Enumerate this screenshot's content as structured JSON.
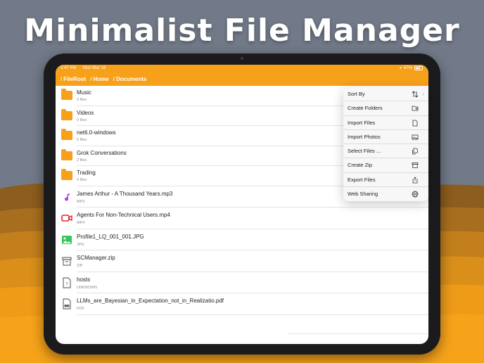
{
  "headline": "Minimalist File Manager",
  "status": {
    "time": "3:47 PM",
    "date": "Mon Mar 16",
    "battery": "67%"
  },
  "breadcrumb": [
    "FileRoot",
    "Home",
    "Documents"
  ],
  "items": [
    {
      "name": "Music",
      "meta": "0 files",
      "kind": "folder"
    },
    {
      "name": "Videos",
      "meta": "0 files",
      "kind": "folder"
    },
    {
      "name": "net6.0-windows",
      "meta": "6 files",
      "kind": "folder"
    },
    {
      "name": "Grok Conversations",
      "meta": "2 files",
      "kind": "folder"
    },
    {
      "name": "Trading",
      "meta": "4 files",
      "kind": "folder"
    },
    {
      "name": "James Arthur - A Thousand Years.mp3",
      "meta": "MP3",
      "kind": "audio"
    },
    {
      "name": "Agents For Non-Technical Users.mp4",
      "meta": "MP4",
      "kind": "video"
    },
    {
      "name": "Profile1_LQ_001_001.JPG",
      "meta": "JPG",
      "kind": "image"
    },
    {
      "name": "SCManager.zip",
      "meta": "ZIP",
      "kind": "zip"
    },
    {
      "name": "hosts",
      "meta": "UNKNOWN",
      "kind": "unknown"
    },
    {
      "name": "LLMs_are_Bayesian_in_Expectation_not_in_Realizatio.pdf",
      "meta": "PDF",
      "kind": "pdf"
    }
  ],
  "menu": [
    {
      "label": "Sort By",
      "icon": "sort-icon"
    },
    {
      "label": "Create Folders",
      "icon": "folder-plus-icon"
    },
    {
      "label": "Import Files",
      "icon": "file-icon"
    },
    {
      "label": "Import Photos",
      "icon": "photo-icon"
    },
    {
      "label": "Select Files ...",
      "icon": "select-files-icon"
    },
    {
      "label": "Create Zip",
      "icon": "archive-icon"
    },
    {
      "label": "Export Files",
      "icon": "share-icon"
    },
    {
      "label": "Web Sharing",
      "icon": "globe-icon"
    }
  ],
  "colors": {
    "accent": "#f7a019",
    "audio": "#b43fe0",
    "video": "#e0262b",
    "image": "#34c759",
    "neutral": "#6b6b6b"
  }
}
